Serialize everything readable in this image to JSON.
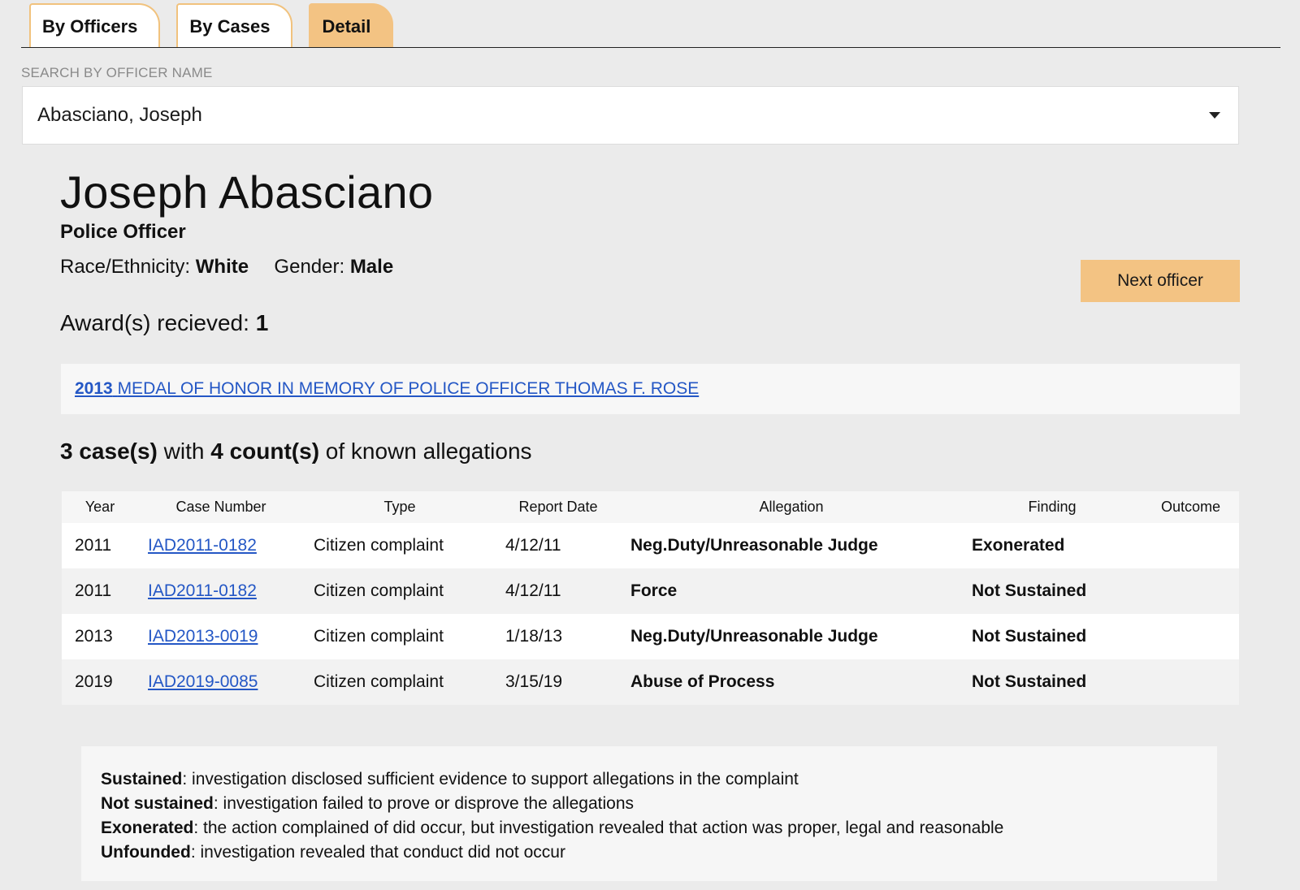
{
  "tabs": [
    {
      "label": "By Officers",
      "active": false
    },
    {
      "label": "By Cases",
      "active": false
    },
    {
      "label": "Detail",
      "active": true
    }
  ],
  "search": {
    "label": "SEARCH BY OFFICER NAME",
    "value": "Abasciano, Joseph"
  },
  "officer": {
    "name": "Joseph Abasciano",
    "rank": "Police Officer",
    "race_label": "Race/Ethnicity:",
    "race": "White",
    "gender_label": "Gender:",
    "gender": "Male",
    "awards_label": "Award(s) recieved:",
    "awards_count": "1"
  },
  "next_button": "Next officer",
  "award": {
    "year": "2013",
    "title": "MEDAL OF HONOR IN MEMORY OF POLICE OFFICER THOMAS F. ROSE"
  },
  "summary": {
    "cases": "3 case(s)",
    "with": " with ",
    "counts": "4 count(s)",
    "suffix": " of known allegations"
  },
  "table": {
    "headers": [
      "Year",
      "Case Number",
      "Type",
      "Report Date",
      "Allegation",
      "Finding",
      "Outcome"
    ],
    "rows": [
      {
        "year": "2011",
        "case": "IAD2011-0182",
        "type": "Citizen complaint",
        "date": "4/12/11",
        "allegation": "Neg.Duty/Unreasonable Judge",
        "finding": "Exonerated",
        "outcome": ""
      },
      {
        "year": "2011",
        "case": "IAD2011-0182",
        "type": "Citizen complaint",
        "date": "4/12/11",
        "allegation": "Force",
        "finding": "Not Sustained",
        "outcome": ""
      },
      {
        "year": "2013",
        "case": "IAD2013-0019",
        "type": "Citizen complaint",
        "date": "1/18/13",
        "allegation": "Neg.Duty/Unreasonable Judge",
        "finding": "Not Sustained",
        "outcome": ""
      },
      {
        "year": "2019",
        "case": "IAD2019-0085",
        "type": "Citizen complaint",
        "date": "3/15/19",
        "allegation": "Abuse of Process",
        "finding": "Not Sustained",
        "outcome": ""
      }
    ]
  },
  "legend": [
    {
      "term": "Sustained",
      "text": ": investigation disclosed sufficient evidence to support allegations in the complaint"
    },
    {
      "term": "Not sustained",
      "text": ": investigation failed to prove or disprove the allegations"
    },
    {
      "term": "Exonerated",
      "text": ": the action complained of did occur, but investigation revealed that action was proper, legal and reasonable"
    },
    {
      "term": "Unfounded",
      "text": ": investigation revealed that conduct did not occur"
    }
  ],
  "colors": {
    "accent": "#f3c383",
    "link": "#2457c5",
    "background": "#ebebeb"
  }
}
